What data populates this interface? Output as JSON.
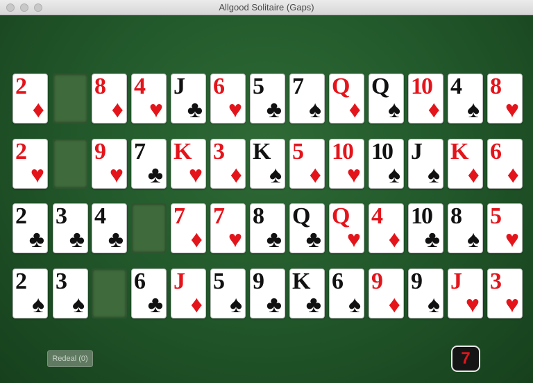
{
  "window": {
    "title": "Allgood Solitaire (Gaps)"
  },
  "colors": {
    "felt": "#235a2c",
    "red_suit": "#e4141b",
    "black_suit": "#111111",
    "gap": "#3f6b3c"
  },
  "board": {
    "rows": [
      [
        {
          "rank": "2",
          "suit": "♦",
          "color": "red"
        },
        {
          "gap": true
        },
        {
          "rank": "8",
          "suit": "♦",
          "color": "red"
        },
        {
          "rank": "4",
          "suit": "♥",
          "color": "red"
        },
        {
          "rank": "J",
          "suit": "♣",
          "color": "black"
        },
        {
          "rank": "6",
          "suit": "♥",
          "color": "red"
        },
        {
          "rank": "5",
          "suit": "♣",
          "color": "black"
        },
        {
          "rank": "7",
          "suit": "♠",
          "color": "black"
        },
        {
          "rank": "Q",
          "suit": "♦",
          "color": "red"
        },
        {
          "rank": "Q",
          "suit": "♠",
          "color": "black"
        },
        {
          "rank": "10",
          "suit": "♦",
          "color": "red"
        },
        {
          "rank": "4",
          "suit": "♠",
          "color": "black"
        },
        {
          "rank": "8",
          "suit": "♥",
          "color": "red"
        }
      ],
      [
        {
          "rank": "2",
          "suit": "♥",
          "color": "red"
        },
        {
          "gap": true
        },
        {
          "rank": "9",
          "suit": "♥",
          "color": "red"
        },
        {
          "rank": "7",
          "suit": "♣",
          "color": "black"
        },
        {
          "rank": "K",
          "suit": "♥",
          "color": "red"
        },
        {
          "rank": "3",
          "suit": "♦",
          "color": "red"
        },
        {
          "rank": "K",
          "suit": "♠",
          "color": "black"
        },
        {
          "rank": "5",
          "suit": "♦",
          "color": "red"
        },
        {
          "rank": "10",
          "suit": "♥",
          "color": "red"
        },
        {
          "rank": "10",
          "suit": "♠",
          "color": "black"
        },
        {
          "rank": "J",
          "suit": "♠",
          "color": "black"
        },
        {
          "rank": "K",
          "suit": "♦",
          "color": "red"
        },
        {
          "rank": "6",
          "suit": "♦",
          "color": "red"
        }
      ],
      [
        {
          "rank": "2",
          "suit": "♣",
          "color": "black"
        },
        {
          "rank": "3",
          "suit": "♣",
          "color": "black"
        },
        {
          "rank": "4",
          "suit": "♣",
          "color": "black"
        },
        {
          "gap": true
        },
        {
          "rank": "7",
          "suit": "♦",
          "color": "red"
        },
        {
          "rank": "7",
          "suit": "♥",
          "color": "red"
        },
        {
          "rank": "8",
          "suit": "♣",
          "color": "black"
        },
        {
          "rank": "Q",
          "suit": "♣",
          "color": "black"
        },
        {
          "rank": "Q",
          "suit": "♥",
          "color": "red"
        },
        {
          "rank": "4",
          "suit": "♦",
          "color": "red"
        },
        {
          "rank": "10",
          "suit": "♣",
          "color": "black"
        },
        {
          "rank": "8",
          "suit": "♠",
          "color": "black"
        },
        {
          "rank": "5",
          "suit": "♥",
          "color": "red"
        }
      ],
      [
        {
          "rank": "2",
          "suit": "♠",
          "color": "black"
        },
        {
          "rank": "3",
          "suit": "♠",
          "color": "black"
        },
        {
          "gap": true
        },
        {
          "rank": "6",
          "suit": "♣",
          "color": "black"
        },
        {
          "rank": "J",
          "suit": "♦",
          "color": "red"
        },
        {
          "rank": "5",
          "suit": "♠",
          "color": "black"
        },
        {
          "rank": "9",
          "suit": "♣",
          "color": "black"
        },
        {
          "rank": "K",
          "suit": "♣",
          "color": "black"
        },
        {
          "rank": "6",
          "suit": "♠",
          "color": "black"
        },
        {
          "rank": "9",
          "suit": "♦",
          "color": "red"
        },
        {
          "rank": "9",
          "suit": "♠",
          "color": "black"
        },
        {
          "rank": "J",
          "suit": "♥",
          "color": "red"
        },
        {
          "rank": "3",
          "suit": "♥",
          "color": "red"
        }
      ]
    ]
  },
  "controls": {
    "redeal_label": "Redeal (0)",
    "counter": "7"
  }
}
